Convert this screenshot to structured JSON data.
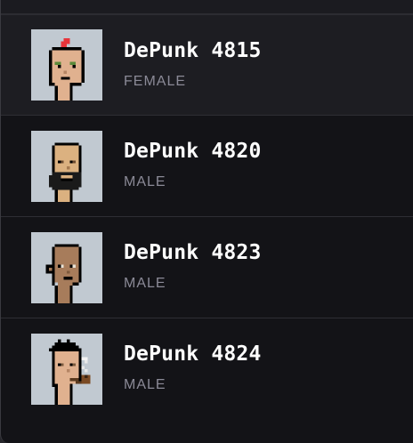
{
  "items": [
    {
      "name": "DePunk 4815",
      "gender": "FEMALE",
      "avatar_icon": "punk-mohawk-avatar"
    },
    {
      "name": "DePunk 4820",
      "gender": "MALE",
      "avatar_icon": "punk-beard-avatar"
    },
    {
      "name": "DePunk 4823",
      "gender": "MALE",
      "avatar_icon": "punk-dark-skin-avatar"
    },
    {
      "name": "DePunk 4824",
      "gender": "MALE",
      "avatar_icon": "punk-pipe-avatar"
    }
  ],
  "colors": {
    "thumb_bg": "#c1c9d1",
    "selected_bg": "#1d1d22",
    "panel_bg": "#131317",
    "name_text": "#ffffff",
    "sub_text": "#8b8a97"
  }
}
